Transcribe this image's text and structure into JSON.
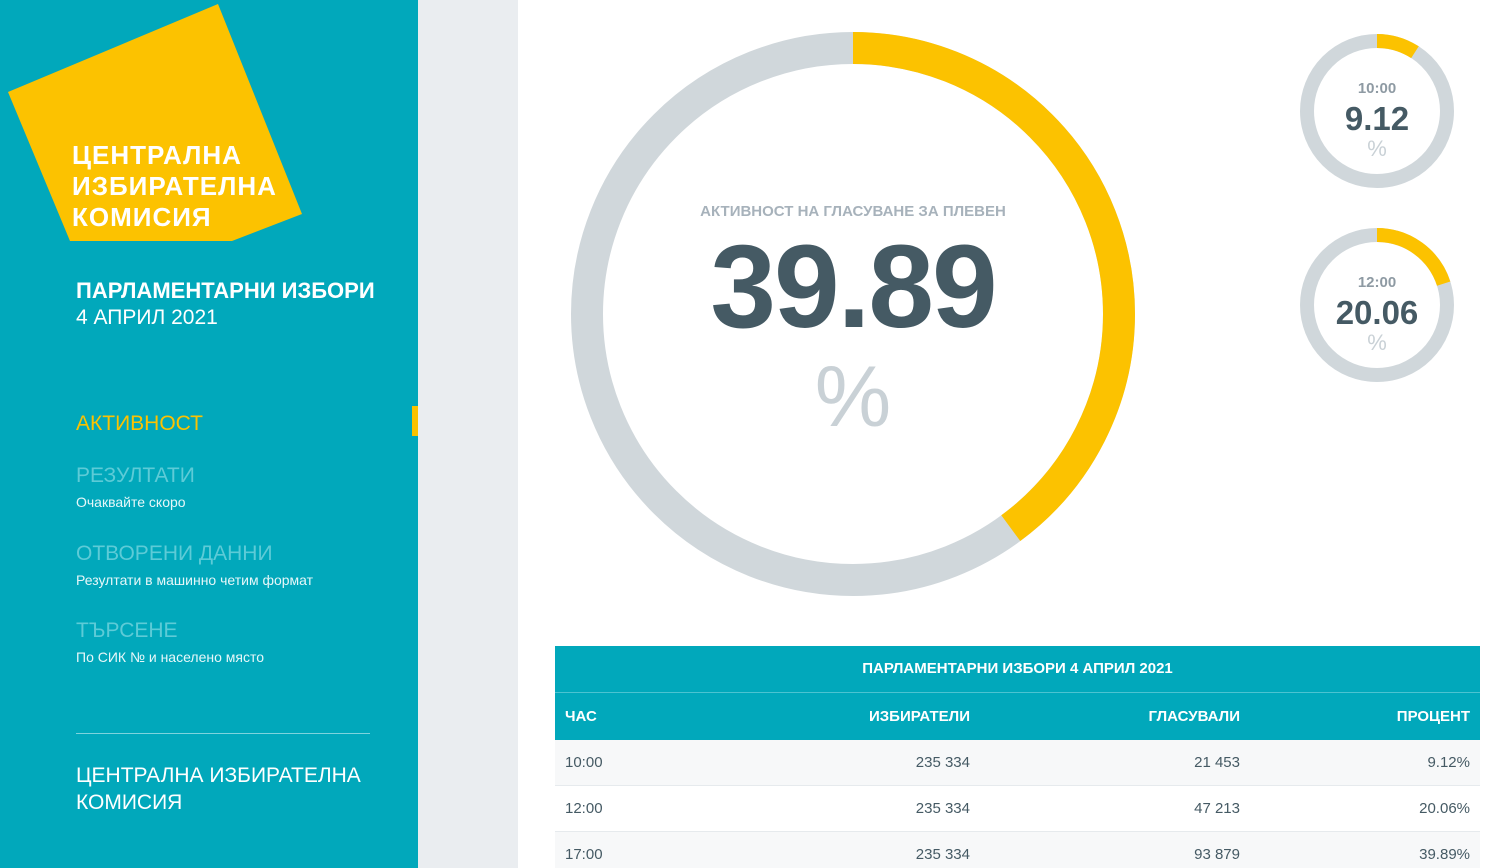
{
  "logo": {
    "lines": [
      "ЦЕНТРАЛНА",
      "ИЗБИРАТЕЛНА",
      "КОМИСИЯ"
    ]
  },
  "election": {
    "title": "ПАРЛАМЕНТАРНИ ИЗБОРИ",
    "date": "4 АПРИЛ 2021"
  },
  "nav": [
    {
      "label": "АКТИВНОСТ",
      "sub": "",
      "active": true
    },
    {
      "label": "РЕЗУЛТАТИ",
      "sub": "Очаквайте скоро",
      "active": false
    },
    {
      "label": "ОТВОРЕНИ ДАННИ",
      "sub": "Резултати в машинно четим формат",
      "active": false
    },
    {
      "label": "ТЪРСЕНЕ",
      "sub": "По СИК № и населено място",
      "active": false
    }
  ],
  "footer": {
    "text": "ЦЕНТРАЛНА ИЗБИРАТЕЛНА КОМИСИЯ"
  },
  "main_gauge": {
    "label": "АКТИВНОСТ НА ГЛАСУВАНЕ ЗА ПЛЕВЕН",
    "value": "39.89",
    "fraction": 0.3989,
    "unit": "%"
  },
  "small_gauges": [
    {
      "time": "10:00",
      "value": "9.12",
      "fraction": 0.0912,
      "unit": "%"
    },
    {
      "time": "12:00",
      "value": "20.06",
      "fraction": 0.2006,
      "unit": "%"
    }
  ],
  "table": {
    "title": "ПАРЛАМЕНТАРНИ ИЗБОРИ 4 АПРИЛ 2021",
    "headers": [
      "ЧАС",
      "ИЗБИРАТЕЛИ",
      "ГЛАСУВАЛИ",
      "ПРОЦЕНТ"
    ],
    "rows": [
      [
        "10:00",
        "235 334",
        "21 453",
        "9.12%"
      ],
      [
        "12:00",
        "235 334",
        "47 213",
        "20.06%"
      ],
      [
        "17:00",
        "235 334",
        "93 879",
        "39.89%"
      ]
    ]
  },
  "colors": {
    "teal": "#01a8bb",
    "yellow": "#fcc200",
    "track": "#d0d7db",
    "text_dark": "#455a64"
  }
}
